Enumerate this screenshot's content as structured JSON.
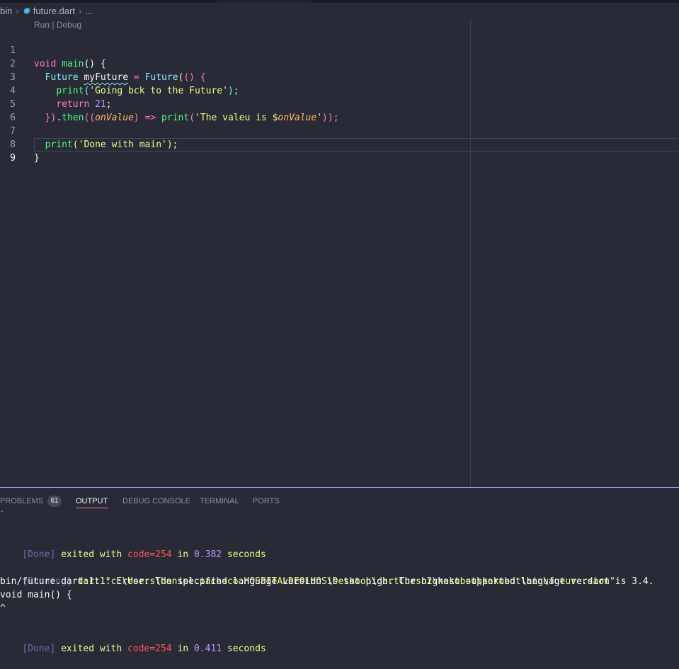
{
  "breadcrumb": {
    "folder": "bin",
    "file": "future.dart",
    "more": "..."
  },
  "codelens": {
    "run": "Run",
    "separator": " | ",
    "debug": "Debug"
  },
  "editor": {
    "line_numbers": [
      "1",
      "2",
      "3",
      "4",
      "5",
      "6",
      "7",
      "8",
      "9"
    ],
    "code": {
      "l1_void": "void ",
      "l1_main": "main",
      "l1_paren": "() {",
      "l2_type": "Future ",
      "l2_var": "myFuture",
      "l2_eq": " = ",
      "l2_ctor": "Future",
      "l2_open": "(",
      "l2_open2": "() {",
      "l3_print": "print",
      "l3_open": "(",
      "l3_str": "'Going bck to the Future'",
      "l3_close": ");",
      "l4_return": "return ",
      "l4_num": "21",
      "l4_semi": ";",
      "l5_close": "})",
      "l5_dot": ".",
      "l5_then": "then",
      "l5_open": "((",
      "l5_param": "onValue",
      "l5_pclose": ") ",
      "l5_arrow": "=>",
      "l5_sp": " ",
      "l5_print": "print",
      "l5_popen": "(",
      "l5_str": "'The valeu is $",
      "l5_interp": "onValue",
      "l5_strend": "'",
      "l5_end": "));",
      "l7_print": "print",
      "l7_open": "(",
      "l7_str": "'Done with main'",
      "l7_close": ");",
      "l8_brace": "}"
    }
  },
  "panel": {
    "tabs": [
      {
        "label": "PROBLEMS",
        "badge": "61"
      },
      {
        "label": "OUTPUT"
      },
      {
        "label": "DEBUG CONSOLE"
      },
      {
        "label": "TERMINAL"
      },
      {
        "label": "PORTS"
      }
    ],
    "active_tab": "OUTPUT"
  },
  "output": {
    "tiny": "^",
    "done1": {
      "tag": "[Done]",
      "exited": " exited with ",
      "code": "code=254",
      "in": " in ",
      "time": "0.382",
      "seconds": " seconds"
    },
    "running": {
      "tag": "[Running]",
      "cmd": " dart \"c:\\Users\\daniel.pacheco.HOSPITALDEOLHOS\\Desktop\\dartCurso2\\kakobot\\kakobot\\bin\\future.dart\""
    },
    "error": "bin/future.dart:1:1: Error: The specified language version is too high. The highest supported language version is 3.4.",
    "src": "void main() {",
    "caret": "^",
    "done2": {
      "tag": "[Done]",
      "exited": " exited with ",
      "code": "code=254",
      "in": " in ",
      "time": "0.411",
      "seconds": " seconds"
    }
  },
  "colors": {
    "background": "#282a36",
    "keyword": "#ff79c6",
    "function": "#50fa7b",
    "type": "#8be9fd",
    "string": "#f1fa8c",
    "number": "#bd93f9",
    "parameter": "#ffb86c",
    "error_code": "#ff5555",
    "panel_border": "#bd93f9"
  },
  "icons": {
    "file_icon": "dart-icon"
  }
}
